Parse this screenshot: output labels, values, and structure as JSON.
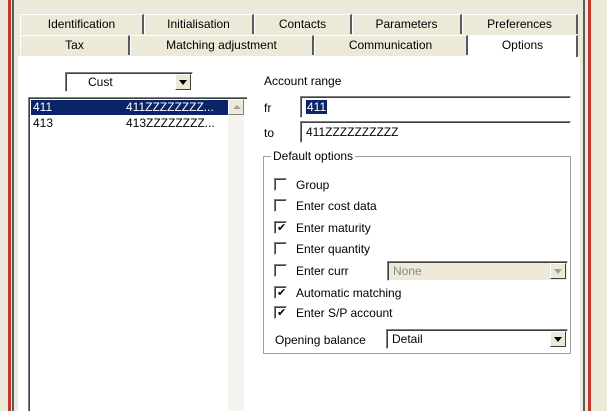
{
  "tabs_row1": [
    "Identification",
    "Initialisation",
    "Contacts",
    "Parameters",
    "Preferences"
  ],
  "tabs_row2": [
    "Tax",
    "Matching adjustment",
    "Communication",
    "Options"
  ],
  "left": {
    "filter": "Cust",
    "list": [
      {
        "code": "411",
        "range": "411ZZZZZZZZ...",
        "selected": true
      },
      {
        "code": "413",
        "range": "413ZZZZZZZZ...",
        "selected": false
      }
    ]
  },
  "account_range": {
    "title": "Account range",
    "from_label": "fr",
    "from_value": "411",
    "to_label": "to",
    "to_value": "411ZZZZZZZZZZ"
  },
  "default_options": {
    "title": "Default options",
    "group": {
      "label": "Group",
      "checked": false
    },
    "enter_cost_data": {
      "label": "Enter cost data",
      "checked": false
    },
    "enter_maturity": {
      "label": "Enter maturity",
      "checked": true
    },
    "enter_quantity": {
      "label": "Enter quantity",
      "checked": false
    },
    "enter_curr": {
      "label": "Enter curr",
      "checked": false,
      "value": "None"
    },
    "automatic_matching": {
      "label": "Automatic matching",
      "checked": true
    },
    "enter_sp_account": {
      "label": "Enter S/P account",
      "checked": true
    },
    "opening_balance": {
      "label": "Opening balance",
      "value": "Detail"
    }
  },
  "colors": {
    "selection": "#0a246a",
    "frame_red": "#c4362b",
    "face": "#ece9d8"
  }
}
